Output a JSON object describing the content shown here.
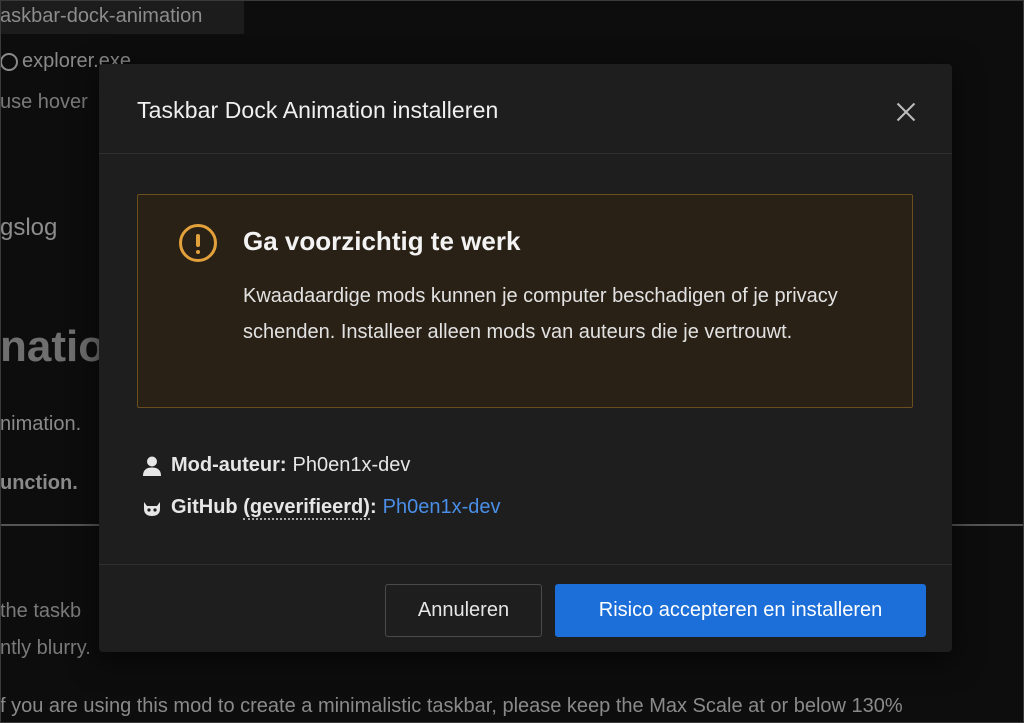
{
  "background": {
    "chip_label": "askbar-dock-animation",
    "process_label": "explorer.exe",
    "hover_text": "use hover",
    "log_text": "gslog",
    "heading_text": "nation",
    "sub_text": "nimation.",
    "bold_text": "unction.",
    "paragraph_line1": "the taskb",
    "paragraph_line2": "ntly blurry.",
    "paragraph_line3": "f you are using this mod to create a minimalistic taskbar, please keep the Max Scale at or below 130%"
  },
  "modal": {
    "title": "Taskbar Dock Animation installeren",
    "close_icon": "close-icon",
    "warning": {
      "icon": "exclamation-circle-icon",
      "title": "Ga voorzichtig te werk",
      "body": "Kwaadaardige mods kunnen je computer beschadigen of je privacy schenden. Installeer alleen mods van auteurs die je vertrouwt."
    },
    "author": {
      "icon": "user-icon",
      "label": "Mod-auteur:",
      "value": "Ph0en1x-dev"
    },
    "github": {
      "icon": "github-icon",
      "label_main": "GitHub",
      "label_verified": "(geverifieerd)",
      "label_colon": ":",
      "link": "Ph0en1x-dev"
    },
    "buttons": {
      "cancel": "Annuleren",
      "accept": "Risico accepteren en installeren"
    }
  },
  "colors": {
    "accent": "#1c6fd8",
    "warning": "#e3a13c",
    "link": "#4a8ee8"
  }
}
